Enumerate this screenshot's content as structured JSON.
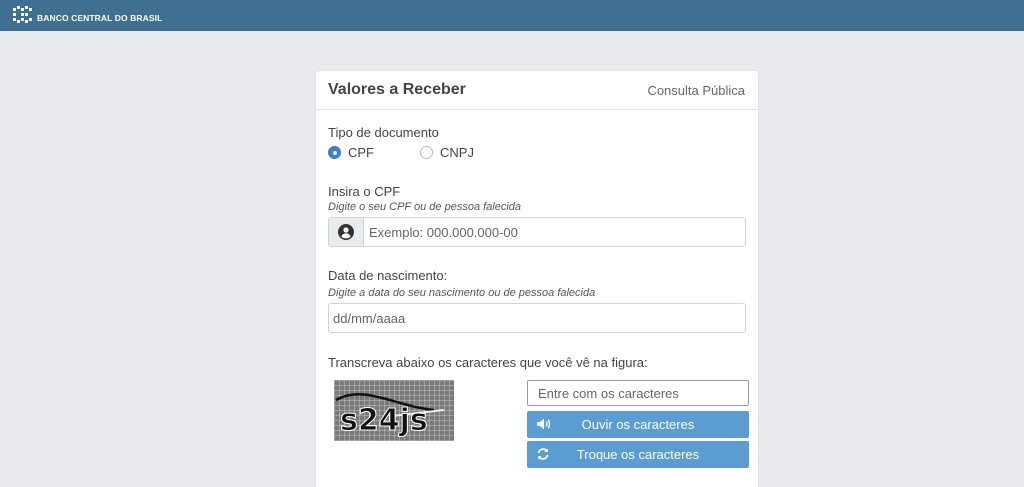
{
  "header": {
    "brand": "BANCO CENTRAL DO BRASIL",
    "logo_icon": "bcb-logo-icon"
  },
  "card": {
    "title": "Valores a Receber",
    "subtitle": "Consulta Pública"
  },
  "document_type": {
    "label": "Tipo de documento",
    "options": [
      {
        "label": "CPF",
        "selected": true
      },
      {
        "label": "CNPJ",
        "selected": false
      }
    ]
  },
  "cpf": {
    "label": "Insira o CPF",
    "hint": "Digite o seu CPF ou de pessoa falecida",
    "placeholder": "Exemplo: 000.000.000-00",
    "icon": "user-circle-icon"
  },
  "birth_date": {
    "label": "Data de nascimento:",
    "hint": "Digite a data do seu nascimento ou de pessoa falecida",
    "placeholder": "dd/mm/aaaa"
  },
  "captcha": {
    "label": "Transcreva abaixo os caracteres que você vê na figura:",
    "image_text": "s24js",
    "input_placeholder": "Entre com os caracteres",
    "listen_label": "Ouvir os caracteres",
    "listen_icon": "volume-icon",
    "refresh_label": "Troque os caracteres",
    "refresh_icon": "refresh-icon"
  },
  "colors": {
    "topbar": "#3f6f91",
    "accent": "#3b7ddd",
    "button": "#5b9dd0",
    "background": "#e9eaed"
  }
}
